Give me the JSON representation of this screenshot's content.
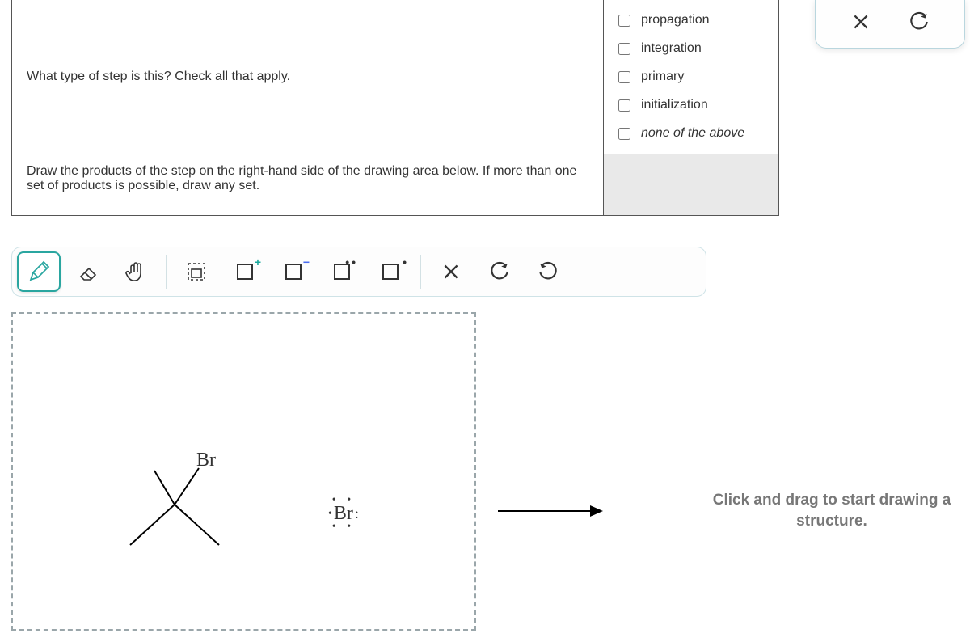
{
  "question": {
    "prompt1": "What type of step is this? Check all that apply.",
    "prompt2": "Draw the products of the step on the right-hand side of the drawing area below. If more than one set of products is possible, draw any set."
  },
  "options": {
    "items": [
      {
        "label": "propagation",
        "checked": false,
        "italic": false
      },
      {
        "label": "integration",
        "checked": false,
        "italic": false
      },
      {
        "label": "primary",
        "checked": false,
        "italic": false
      },
      {
        "label": "initialization",
        "checked": false,
        "italic": false
      },
      {
        "label": "none of the above",
        "checked": false,
        "italic": true
      }
    ]
  },
  "toolbar": {
    "tools": [
      {
        "name": "pencil",
        "selected": true
      },
      {
        "name": "eraser",
        "selected": false
      },
      {
        "name": "hand",
        "selected": false
      },
      {
        "name": "marquee-select",
        "selected": false
      },
      {
        "name": "positive-charge",
        "selected": false
      },
      {
        "name": "negative-charge",
        "selected": false
      },
      {
        "name": "lone-pair",
        "selected": false
      },
      {
        "name": "radical",
        "selected": false
      }
    ],
    "actions": [
      {
        "name": "clear"
      },
      {
        "name": "undo"
      },
      {
        "name": "redo"
      }
    ]
  },
  "float_panel": {
    "close": "×",
    "reset": "↺"
  },
  "drawing": {
    "reactants": {
      "molecule1": {
        "substituent": "Br"
      },
      "molecule2": {
        "atom": "Br",
        "radical": true,
        "lone_pairs": 3
      }
    },
    "product_hint": "Click and drag to start drawing a structure."
  }
}
